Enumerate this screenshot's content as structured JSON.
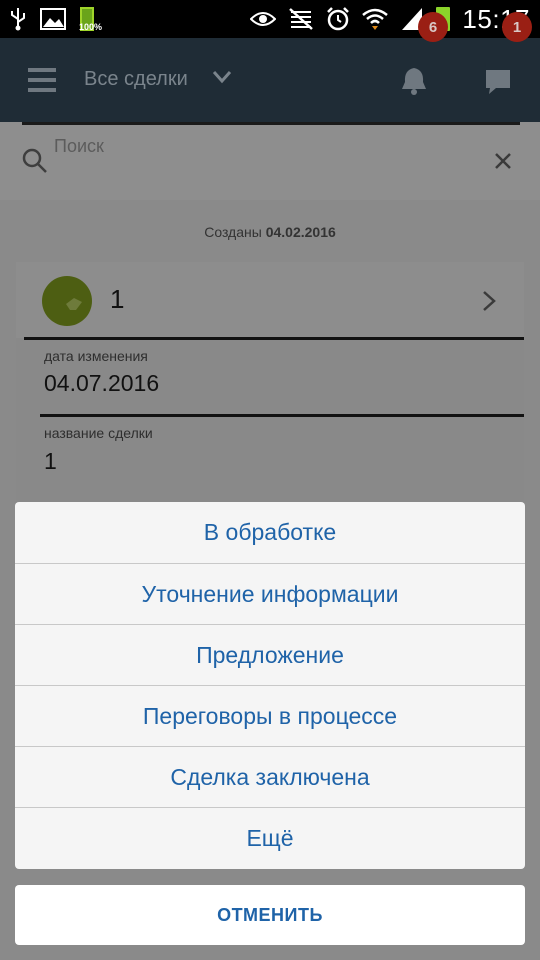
{
  "status_bar": {
    "battery_left_text": "100%",
    "time": "15:17",
    "icons": [
      "usb-icon",
      "image-icon",
      "battery-icon",
      "eye-icon",
      "mute-icon",
      "alarm-icon",
      "wifi-icon",
      "signal-icon",
      "battery-icon"
    ]
  },
  "header": {
    "title": "Все сделки",
    "notifications_count": "6",
    "messages_count": "1",
    "badge_color": "#9a1f14"
  },
  "search": {
    "placeholder": "Поиск"
  },
  "list": {
    "group_prefix": "Созданы",
    "group_date": "04.02.2016",
    "card": {
      "title": "1",
      "fields": [
        {
          "label": "дата изменения",
          "value": "04.07.2016"
        },
        {
          "label": "название сделки",
          "value": "1"
        }
      ]
    }
  },
  "action_sheet": {
    "items": [
      "В обработке",
      "Уточнение информации",
      "Предложение",
      "Переговоры в процессе",
      "Сделка заключена",
      "Ещё"
    ],
    "cancel_label": "ОТМЕНИТЬ",
    "accent_color": "#1f63a8"
  }
}
